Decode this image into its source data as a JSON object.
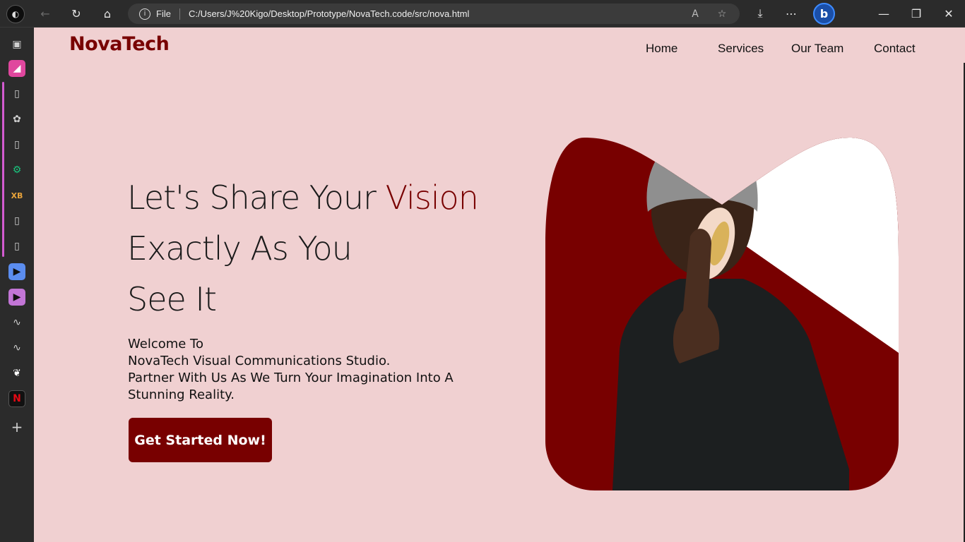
{
  "browser": {
    "address_scheme": "File",
    "url": "C:/Users/J%20Kigo/Desktop/Prototype/NovaTech.code/src/nova.html"
  },
  "site": {
    "brand": "NovaTech",
    "brand_color": "#780000",
    "background_color": "#f0d0d1",
    "nav": [
      "Home",
      "Services",
      "Our Team",
      "Contact"
    ]
  },
  "hero": {
    "title_line1_pre": "Let's Share Your ",
    "title_line1_accent": "Vision",
    "title_line2": "Exactly As You",
    "title_line3": "See It",
    "subtitle_line1": "Welcome To",
    "subtitle_line2": "NovaTech Visual Communications Studio.",
    "subtitle_line3": "Partner With Us As We Turn Your Imagination Into A Stunning Reality.",
    "cta_label": "Get Started Now!"
  },
  "icons": {
    "toolbar": [
      "profile-icon",
      "back-icon",
      "refresh-icon",
      "home-icon",
      "info-icon",
      "read-aloud-icon",
      "favorite-icon",
      "download-icon",
      "more-icon",
      "bing-icon",
      "minimize-icon",
      "restore-icon",
      "close-icon"
    ],
    "sidebar": [
      "tab-actions-icon",
      "collections-icon",
      "page-icon",
      "brain-icon",
      "page-icon",
      "chatgpt-icon",
      "app-icon",
      "settings-page-icon",
      "page-icon",
      "play-icon",
      "play-icon",
      "wave-icon",
      "wave-icon",
      "leaf-icon",
      "netflix-icon",
      "add-icon"
    ]
  }
}
